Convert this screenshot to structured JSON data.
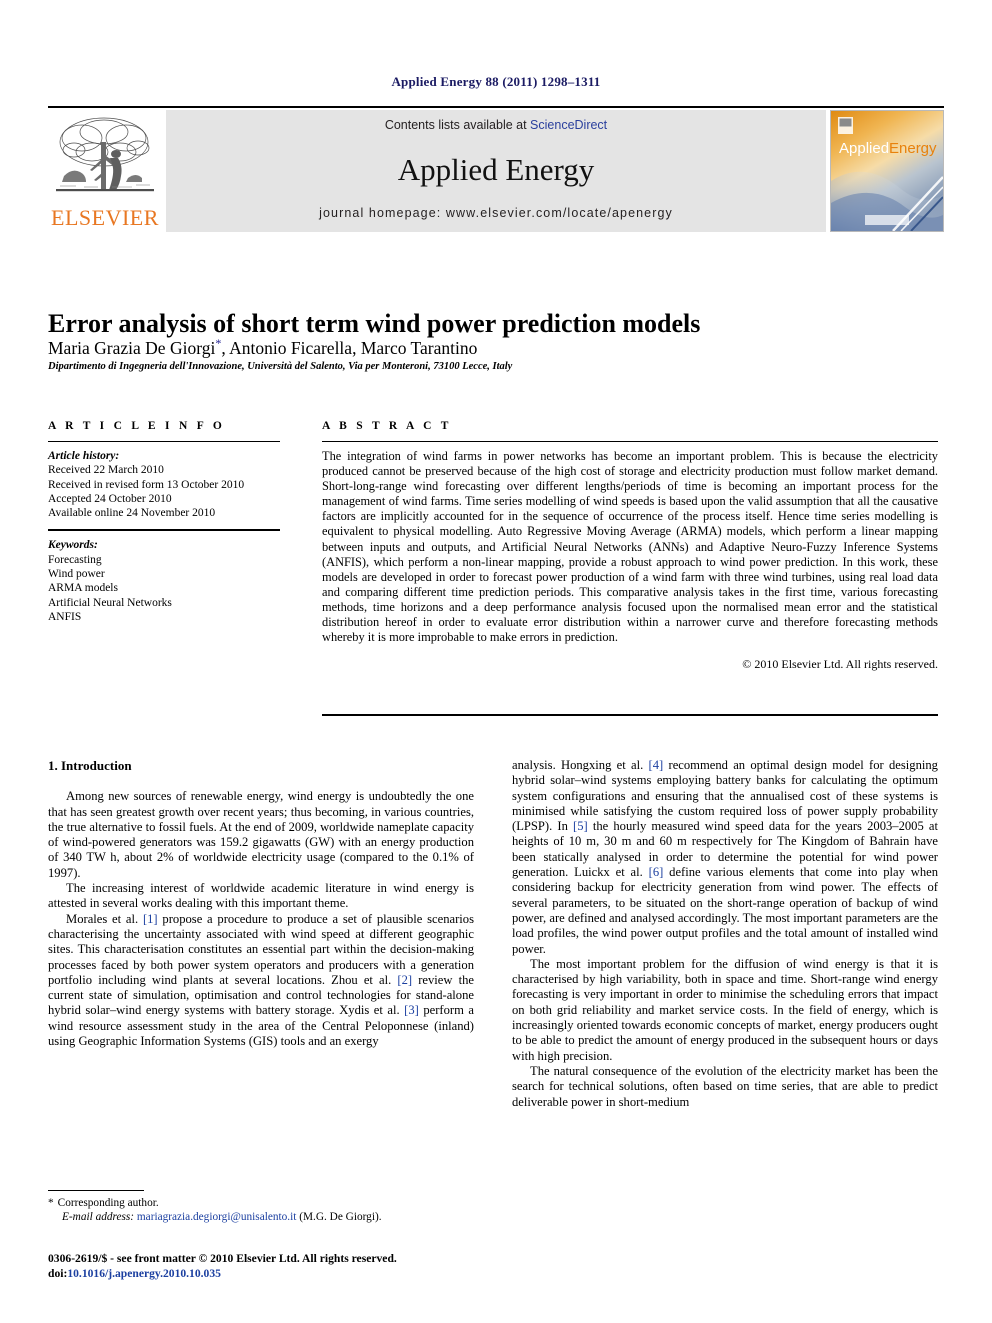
{
  "running_head": "Applied Energy 88 (2011) 1298–1311",
  "journal_header": {
    "publisher_name": "ELSEVIER",
    "contents_prefix": "Contents lists available at ",
    "contents_link": "ScienceDirect",
    "journal_title": "Applied Energy",
    "homepage_line": "journal homepage: www.elsevier.com/locate/apenergy",
    "cover_title_part1": "Applied",
    "cover_title_part2": "Energy",
    "accent_orange": "#e87722",
    "link_blue": "#2a3f9d"
  },
  "article": {
    "title": "Error analysis of short term wind power prediction models",
    "authors": "Maria Grazia De Giorgi",
    "authors_rest": ", Antonio Ficarella, Marco Tarantino",
    "corresponding_marker": "*",
    "affiliation": "Dipartimento di Ingegneria dell'Innovazione, Università del Salento, Via per Monteroni, 73100 Lecce, Italy"
  },
  "article_info": {
    "heading": "A R T I C L E   I N F O",
    "history_label": "Article history:",
    "history": [
      "Received 22 March 2010",
      "Received in revised form 13 October 2010",
      "Accepted 24 October 2010",
      "Available online 24 November 2010"
    ],
    "keywords_label": "Keywords:",
    "keywords": [
      "Forecasting",
      "Wind power",
      "ARMA models",
      "Artificial Neural Networks",
      "ANFIS"
    ]
  },
  "abstract": {
    "heading": "A B S T R A C T",
    "text": "The integration of wind farms in power networks has become an important problem. This is because the electricity produced cannot be preserved because of the high cost of storage and electricity production must follow market demand. Short-long-range wind forecasting over different lengths/periods of time is becoming an important process for the management of wind farms. Time series modelling of wind speeds is based upon the valid assumption that all the causative factors are implicitly accounted for in the sequence of occurrence of the process itself. Hence time series modelling is equivalent to physical modelling. Auto Regressive Moving Average (ARMA) models, which perform a linear mapping between inputs and outputs, and Artificial Neural Networks (ANNs) and Adaptive Neuro-Fuzzy Inference Systems (ANFIS), which perform a non-linear mapping, provide a robust approach to wind power prediction. In this work, these models are developed in order to forecast power production of a wind farm with three wind turbines, using real load data and comparing different time prediction periods. This comparative analysis takes in the first time, various forecasting methods, time horizons and a deep performance analysis focused upon the normalised mean error and the statistical distribution hereof in order to evaluate error distribution within a narrower curve and therefore forecasting methods whereby it is more improbable to make errors in prediction.",
    "copyright": "© 2010 Elsevier Ltd. All rights reserved."
  },
  "body": {
    "section_number_title": "1. Introduction",
    "left_paragraphs": [
      "Among new sources of renewable energy, wind energy is undoubtedly the one that has seen greatest growth over recent years; thus becoming, in various countries, the true alternative to fossil fuels. At the end of 2009, worldwide nameplate capacity of wind-powered generators was 159.2 gigawatts (GW) with an energy production of 340 TW h, about 2% of worldwide electricity usage (compared to the 0.1% of 1997).",
      "The increasing interest of worldwide academic literature in wind energy is attested in several works dealing with this important theme."
    ],
    "left_para3_a": "Morales et al. ",
    "left_para3_ref1": "[1]",
    "left_para3_b": " propose a procedure to produce a set of plausible scenarios characterising the uncertainty associated with wind speed at different geographic sites. This characterisation constitutes an essential part within the decision-making processes faced by both power system operators and producers with a generation portfolio including wind plants at several locations. Zhou et al. ",
    "left_para3_ref2": "[2]",
    "left_para3_c": " review the current state of simulation, optimisation and control technologies for stand-alone hybrid solar–wind energy systems with battery storage. Xydis et al. ",
    "left_para3_ref3": "[3]",
    "left_para3_d": " perform a wind resource assessment study in the area of the Central Peloponnese (inland) using Geographic Information Systems (GIS) tools and an exergy",
    "right_para1_a": "analysis. Hongxing et al. ",
    "right_para1_ref4": "[4]",
    "right_para1_b": " recommend an optimal design model for designing hybrid solar–wind systems employing battery banks for calculating the optimum system configurations and ensuring that the annualised cost of these systems is minimised while satisfying the custom required loss of power supply probability (LPSP). In ",
    "right_para1_ref5": "[5]",
    "right_para1_c": " the hourly measured wind speed data for the years 2003–2005 at heights of 10 m, 30 m and 60 m respectively for The Kingdom of Bahrain have been statically analysed in order to determine the potential for wind power generation. Luickx et al. ",
    "right_para1_ref6": "[6]",
    "right_para1_d": " define various elements that come into play when considering backup for electricity generation from wind power. The effects of several parameters, to be situated on the short-range operation of backup of wind power, are defined and analysed accordingly. The most important parameters are the load profiles, the wind power output profiles and the total amount of installed wind power.",
    "right_paragraphs": [
      "The most important problem for the diffusion of wind energy is that it is characterised by high variability, both in space and time. Short-range wind energy forecasting is very important in order to minimise the scheduling errors that impact on both grid reliability and market service costs. In the field of energy, which is increasingly oriented towards economic concepts of market, energy producers ought to be able to predict the amount of energy produced in the subsequent hours or days with high precision.",
      "The natural consequence of the evolution of the electricity market has been the search for technical solutions, often based on time series, that are able to predict deliverable power in short-medium"
    ]
  },
  "footnotes": {
    "corresponding_marker": "*",
    "corresponding_text": "Corresponding author.",
    "email_label": "E-mail address:",
    "email": "mariagrazia.degiorgi@unisalento.it",
    "email_owner": "(M.G. De Giorgi).",
    "issn_line": "0306-2619/$ - see front matter © 2010 Elsevier Ltd. All rights reserved.",
    "doi_label": "doi:",
    "doi": "10.1016/j.apenergy.2010.10.035"
  }
}
